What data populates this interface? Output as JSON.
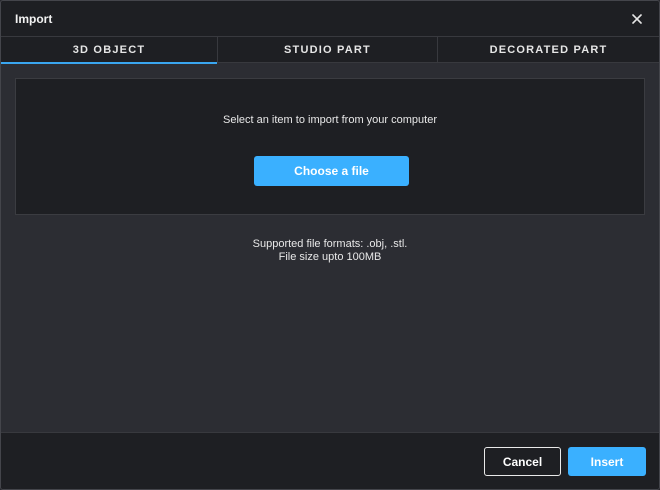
{
  "dialog": {
    "title": "Import",
    "close_icon": "close-icon"
  },
  "tabs": [
    {
      "label": "3D OBJECT",
      "active": true
    },
    {
      "label": "STUDIO PART",
      "active": false
    },
    {
      "label": "DECORATED PART",
      "active": false
    }
  ],
  "dropzone": {
    "message": "Select an item to import from your computer",
    "choose_label": "Choose a file"
  },
  "info": {
    "formats": "Supported file formats: .obj, .stl.",
    "size": "File size upto 100MB"
  },
  "footer": {
    "cancel_label": "Cancel",
    "insert_label": "Insert"
  },
  "colors": {
    "accent": "#3ab0ff",
    "background": "#2c2d33",
    "panel": "#1e1f23"
  }
}
